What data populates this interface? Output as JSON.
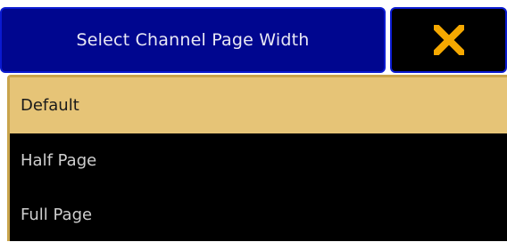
{
  "dialog": {
    "title": "Select Channel Page Width",
    "close_icon": "close-x-icon",
    "accent_color": "#00068f",
    "close_icon_color": "#f5a800"
  },
  "options": {
    "selected_index": 0,
    "selected_color": "#e6c477",
    "items": [
      {
        "label": "Default"
      },
      {
        "label": "Half Page"
      },
      {
        "label": "Full Page"
      }
    ]
  }
}
